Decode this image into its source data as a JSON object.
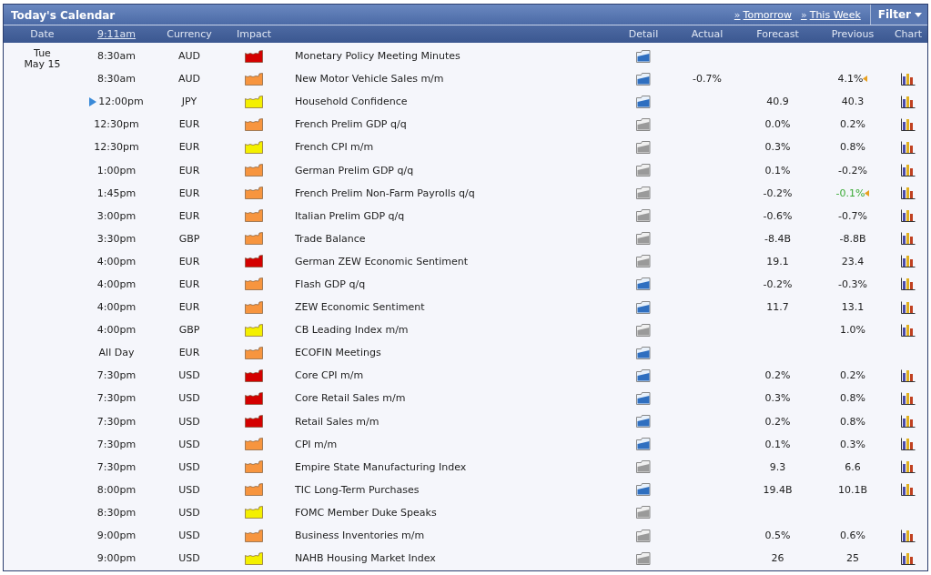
{
  "title": "Today's Calendar",
  "links": [
    {
      "prefix": "»",
      "label": "Tomorrow"
    },
    {
      "prefix": "»",
      "label": "This Week"
    }
  ],
  "filter": {
    "label": "Filter"
  },
  "columns": [
    "Date",
    "9:11am",
    "Currency",
    "Impact",
    "",
    "Detail",
    "Actual",
    "Forecast",
    "Previous",
    "Chart"
  ],
  "date": {
    "weekday": "Tue",
    "day": "May 15"
  },
  "rows": [
    {
      "time": "8:30am",
      "currency": "AUD",
      "impact": {
        "color": "#d40000"
      },
      "event": "Monetary Policy Meeting Minutes",
      "detail_updated": true,
      "actual": "",
      "forecast": "",
      "previous": "",
      "previous_revised": false,
      "previous_better": false,
      "chart": false,
      "current": false
    },
    {
      "time": "8:30am",
      "currency": "AUD",
      "impact": {
        "color": "#f7953f"
      },
      "event": "New Motor Vehicle Sales m/m",
      "detail_updated": true,
      "actual": "-0.7%",
      "forecast": "",
      "previous": "4.1%",
      "previous_revised": true,
      "previous_better": false,
      "chart": true,
      "current": false
    },
    {
      "time": "12:00pm",
      "currency": "JPY",
      "impact": {
        "color": "#f4f000"
      },
      "event": "Household Confidence",
      "detail_updated": true,
      "actual": "",
      "forecast": "40.9",
      "previous": "40.3",
      "previous_revised": false,
      "previous_better": false,
      "chart": true,
      "current": true
    },
    {
      "time": "12:30pm",
      "currency": "EUR",
      "impact": {
        "color": "#f7953f"
      },
      "event": "French Prelim GDP q/q",
      "detail_updated": false,
      "actual": "",
      "forecast": "0.0%",
      "previous": "0.2%",
      "previous_revised": false,
      "previous_better": false,
      "chart": true,
      "current": false
    },
    {
      "time": "12:30pm",
      "currency": "EUR",
      "impact": {
        "color": "#f4f000"
      },
      "event": "French CPI m/m",
      "detail_updated": false,
      "actual": "",
      "forecast": "0.3%",
      "previous": "0.8%",
      "previous_revised": false,
      "previous_better": false,
      "chart": true,
      "current": false
    },
    {
      "time": "1:00pm",
      "currency": "EUR",
      "impact": {
        "color": "#f7953f"
      },
      "event": "German Prelim GDP q/q",
      "detail_updated": false,
      "actual": "",
      "forecast": "0.1%",
      "previous": "-0.2%",
      "previous_revised": false,
      "previous_better": false,
      "chart": true,
      "current": false
    },
    {
      "time": "1:45pm",
      "currency": "EUR",
      "impact": {
        "color": "#f7953f"
      },
      "event": "French Prelim Non-Farm Payrolls q/q",
      "detail_updated": false,
      "actual": "",
      "forecast": "-0.2%",
      "previous": "-0.1%",
      "previous_revised": true,
      "previous_better": true,
      "chart": true,
      "current": false
    },
    {
      "time": "3:00pm",
      "currency": "EUR",
      "impact": {
        "color": "#f7953f"
      },
      "event": "Italian Prelim GDP q/q",
      "detail_updated": false,
      "actual": "",
      "forecast": "-0.6%",
      "previous": "-0.7%",
      "previous_revised": false,
      "previous_better": false,
      "chart": true,
      "current": false
    },
    {
      "time": "3:30pm",
      "currency": "GBP",
      "impact": {
        "color": "#f7953f"
      },
      "event": "Trade Balance",
      "detail_updated": false,
      "actual": "",
      "forecast": "-8.4B",
      "previous": "-8.8B",
      "previous_revised": false,
      "previous_better": false,
      "chart": true,
      "current": false
    },
    {
      "time": "4:00pm",
      "currency": "EUR",
      "impact": {
        "color": "#d40000"
      },
      "event": "German ZEW Economic Sentiment",
      "detail_updated": false,
      "actual": "",
      "forecast": "19.1",
      "previous": "23.4",
      "previous_revised": false,
      "previous_better": false,
      "chart": true,
      "current": false
    },
    {
      "time": "4:00pm",
      "currency": "EUR",
      "impact": {
        "color": "#f7953f"
      },
      "event": "Flash GDP q/q",
      "detail_updated": true,
      "actual": "",
      "forecast": "-0.2%",
      "previous": "-0.3%",
      "previous_revised": false,
      "previous_better": false,
      "chart": true,
      "current": false
    },
    {
      "time": "4:00pm",
      "currency": "EUR",
      "impact": {
        "color": "#f7953f"
      },
      "event": "ZEW Economic Sentiment",
      "detail_updated": true,
      "actual": "",
      "forecast": "11.7",
      "previous": "13.1",
      "previous_revised": false,
      "previous_better": false,
      "chart": true,
      "current": false
    },
    {
      "time": "4:00pm",
      "currency": "GBP",
      "impact": {
        "color": "#f4f000"
      },
      "event": "CB Leading Index m/m",
      "detail_updated": false,
      "actual": "",
      "forecast": "",
      "previous": "1.0%",
      "previous_revised": false,
      "previous_better": false,
      "chart": true,
      "current": false
    },
    {
      "time": "All Day",
      "currency": "EUR",
      "impact": {
        "color": "#f7953f"
      },
      "event": "ECOFIN Meetings",
      "detail_updated": true,
      "actual": "",
      "forecast": "",
      "previous": "",
      "previous_revised": false,
      "previous_better": false,
      "chart": false,
      "current": false
    },
    {
      "time": "7:30pm",
      "currency": "USD",
      "impact": {
        "color": "#d40000"
      },
      "event": "Core CPI m/m",
      "detail_updated": true,
      "actual": "",
      "forecast": "0.2%",
      "previous": "0.2%",
      "previous_revised": false,
      "previous_better": false,
      "chart": true,
      "current": false
    },
    {
      "time": "7:30pm",
      "currency": "USD",
      "impact": {
        "color": "#d40000"
      },
      "event": "Core Retail Sales m/m",
      "detail_updated": true,
      "actual": "",
      "forecast": "0.3%",
      "previous": "0.8%",
      "previous_revised": false,
      "previous_better": false,
      "chart": true,
      "current": false
    },
    {
      "time": "7:30pm",
      "currency": "USD",
      "impact": {
        "color": "#d40000"
      },
      "event": "Retail Sales m/m",
      "detail_updated": true,
      "actual": "",
      "forecast": "0.2%",
      "previous": "0.8%",
      "previous_revised": false,
      "previous_better": false,
      "chart": true,
      "current": false
    },
    {
      "time": "7:30pm",
      "currency": "USD",
      "impact": {
        "color": "#f7953f"
      },
      "event": "CPI m/m",
      "detail_updated": true,
      "actual": "",
      "forecast": "0.1%",
      "previous": "0.3%",
      "previous_revised": false,
      "previous_better": false,
      "chart": true,
      "current": false
    },
    {
      "time": "7:30pm",
      "currency": "USD",
      "impact": {
        "color": "#f7953f"
      },
      "event": "Empire State Manufacturing Index",
      "detail_updated": false,
      "actual": "",
      "forecast": "9.3",
      "previous": "6.6",
      "previous_revised": false,
      "previous_better": false,
      "chart": true,
      "current": false
    },
    {
      "time": "8:00pm",
      "currency": "USD",
      "impact": {
        "color": "#f7953f"
      },
      "event": "TIC Long-Term Purchases",
      "detail_updated": true,
      "actual": "",
      "forecast": "19.4B",
      "previous": "10.1B",
      "previous_revised": false,
      "previous_better": false,
      "chart": true,
      "current": false
    },
    {
      "time": "8:30pm",
      "currency": "USD",
      "impact": {
        "color": "#f4f000"
      },
      "event": "FOMC Member Duke Speaks",
      "detail_updated": false,
      "actual": "",
      "forecast": "",
      "previous": "",
      "previous_revised": false,
      "previous_better": false,
      "chart": false,
      "current": false
    },
    {
      "time": "9:00pm",
      "currency": "USD",
      "impact": {
        "color": "#f7953f"
      },
      "event": "Business Inventories m/m",
      "detail_updated": false,
      "actual": "",
      "forecast": "0.5%",
      "previous": "0.6%",
      "previous_revised": false,
      "previous_better": false,
      "chart": true,
      "current": false
    },
    {
      "time": "9:00pm",
      "currency": "USD",
      "impact": {
        "color": "#f4f000"
      },
      "event": "NAHB Housing Market Index",
      "detail_updated": false,
      "actual": "",
      "forecast": "26",
      "previous": "25",
      "previous_revised": false,
      "previous_better": false,
      "chart": true,
      "current": false
    }
  ]
}
